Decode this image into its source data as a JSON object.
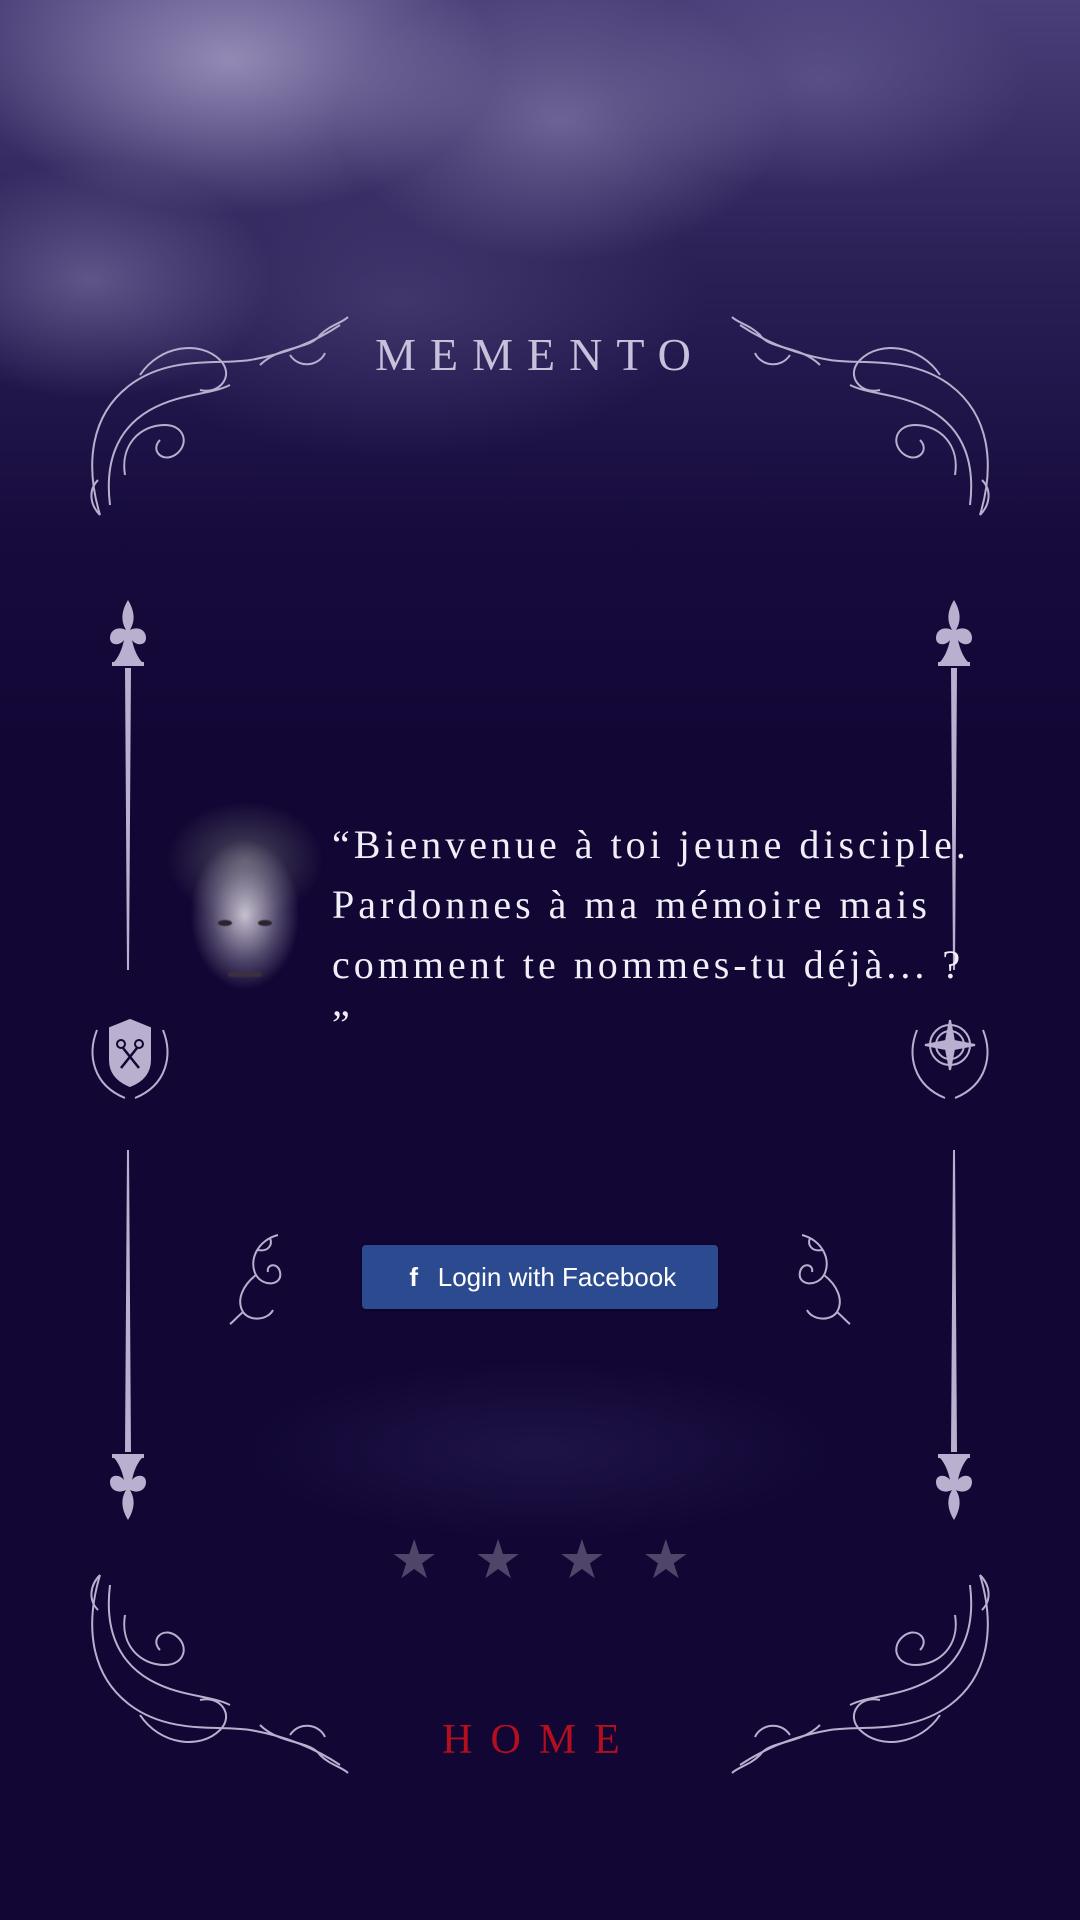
{
  "app": {
    "title": "MEMENTO"
  },
  "dialog": {
    "quote": "“Bienvenue à toi jeune disciple. Pardonnes à ma mémoire mais comment te nommes-tu déjà... ? ”"
  },
  "login": {
    "facebook_label": "Login with Facebook",
    "icon": "facebook-icon"
  },
  "rating": {
    "stars": 4
  },
  "nav": {
    "home_label": "HOME"
  },
  "colors": {
    "background": "#110634",
    "facebook": "#2c4a8f",
    "home": "#b40f1f",
    "ornament": "#b9b0cf",
    "star": "#4e4568"
  }
}
